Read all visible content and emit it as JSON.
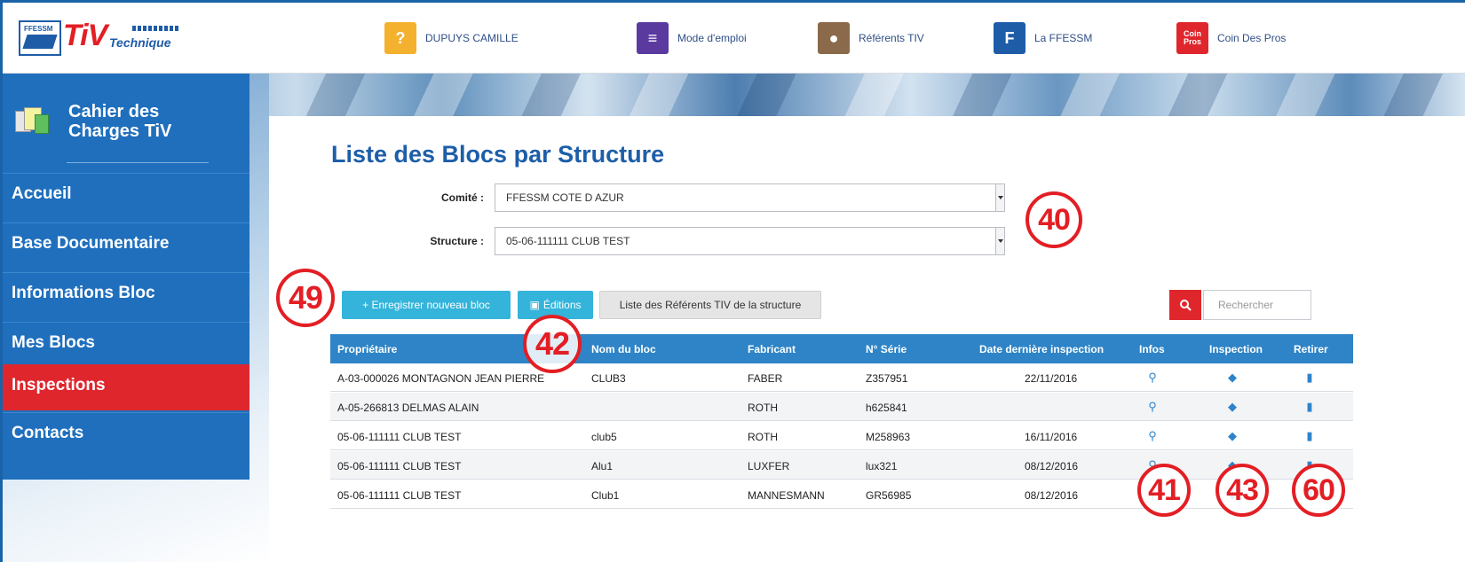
{
  "brand": {
    "logo_small": "FFESSM",
    "logo_tiv": "TiV",
    "logo_tech": "Technique"
  },
  "topnav": [
    {
      "label": "DUPUYS CAMILLE",
      "icon": "lock-user-icon",
      "color": "#f4b12d",
      "glyph": "?"
    },
    {
      "label": "Mode d'emploi",
      "icon": "manual-icon",
      "color": "#5b3aa0",
      "glyph": "≡"
    },
    {
      "label": "Référents TIV",
      "icon": "referents-icon",
      "color": "#8a6a4a",
      "glyph": "●"
    },
    {
      "label": "La FFESSM",
      "icon": "ffessm-icon",
      "color": "#1e5ca8",
      "glyph": "F"
    },
    {
      "label": "Coin Des Pros",
      "icon": "coin-pros-icon",
      "color": "#e0262d",
      "glyph": "Coin Pros"
    }
  ],
  "sidebar": {
    "title": "Cahier des Charges TiV",
    "items": [
      {
        "label": "Accueil",
        "active": false
      },
      {
        "label": "Base Documentaire",
        "active": false
      },
      {
        "label": "Informations Bloc",
        "active": false
      },
      {
        "label": "Mes Blocs",
        "active": false
      },
      {
        "label": "Inspections",
        "active": true
      },
      {
        "label": "Contacts",
        "active": false
      }
    ]
  },
  "main": {
    "title": "Liste des Blocs par Structure",
    "comite_label": "Comité :",
    "comite_value": "FFESSM COTE D AZUR",
    "structure_label": "Structure :",
    "structure_value": "05-06-111111 CLUB TEST",
    "btn_new": "+ Enregistrer nouveau bloc",
    "btn_editions": "Éditions",
    "btn_referents": "Liste des Référents TIV de la structure",
    "search_placeholder": "Rechercher"
  },
  "table": {
    "headers": [
      "Propriétaire",
      "Nom du bloc",
      "Fabricant",
      "N° Série",
      "Date dernière inspection",
      "Infos",
      "Inspection",
      "Retirer"
    ],
    "rows": [
      [
        "A-03-000026 MONTAGNON JEAN PIERRE",
        "CLUB3",
        "FABER",
        "Z357951",
        "22/11/2016"
      ],
      [
        "A-05-266813 DELMAS ALAIN",
        "",
        "ROTH",
        "h625841",
        ""
      ],
      [
        "05-06-111111 CLUB TEST",
        "club5",
        "ROTH",
        "M258963",
        "16/11/2016"
      ],
      [
        "05-06-111111 CLUB TEST",
        "Alu1",
        "LUXFER",
        "lux321",
        "08/12/2016"
      ],
      [
        "05-06-111111 CLUB TEST",
        "Club1",
        "MANNESMANN",
        "GR56985",
        "08/12/2016"
      ]
    ]
  },
  "annotations": {
    "a40": "40",
    "a49": "49",
    "a42": "42",
    "a41": "41",
    "a43": "43",
    "a60": "60"
  },
  "colors": {
    "primary_blue": "#1f6fbd",
    "active_red": "#e0262d",
    "button_cyan": "#34b4da",
    "table_header": "#2e84c6",
    "annotation_red": "#e31e24"
  }
}
